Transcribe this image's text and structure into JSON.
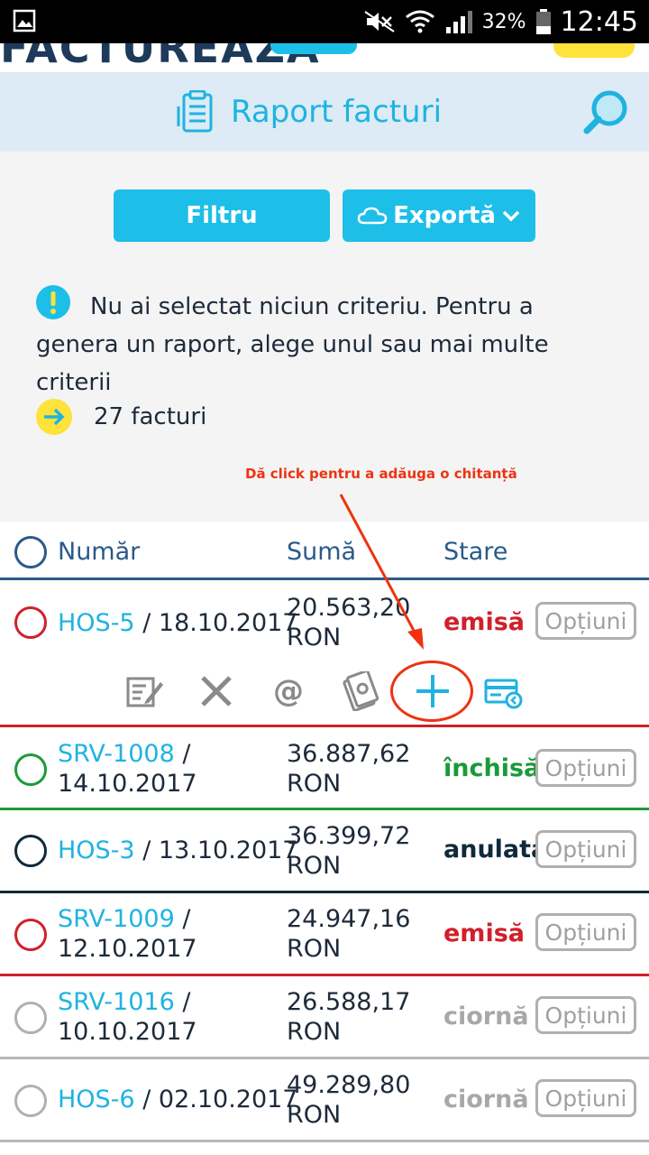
{
  "status_bar": {
    "battery_pct": "32%",
    "time": "12:45"
  },
  "app": {
    "logo_fragment": "FACTUREAZA"
  },
  "header": {
    "title": "Raport facturi"
  },
  "filters": {
    "filter_label": "Filtru",
    "export_label": "Exportă"
  },
  "notice": {
    "text": "Nu ai selectat niciun criteriu. Pentru a genera un raport, alege unul sau mai multe criterii",
    "count": "27 facturi"
  },
  "hint": "Dă click pentru a adăuga o chitanță",
  "table": {
    "headers": {
      "number": "Număr",
      "sum": "Sumă",
      "status": "Stare"
    },
    "options_label": "Opțiuni",
    "rows": [
      {
        "code": "HOS-5",
        "date": "/ 18.10.2017",
        "amount": "20.563,20",
        "currency": "RON",
        "status": "emisă",
        "status_color": "#d0202a"
      },
      {
        "code": "SRV-1008",
        "date": "/ 14.10.2017",
        "amount": "36.887,62",
        "currency": "RON",
        "status": "închisă",
        "status_color": "#1a9a3a"
      },
      {
        "code": "HOS-3",
        "date": "/ 13.10.2017",
        "amount": "36.399,72",
        "currency": "RON",
        "status": "anulată",
        "status_color": "#0f2a3a"
      },
      {
        "code": "SRV-1009",
        "date": "/ 12.10.2017",
        "amount": "24.947,16",
        "currency": "RON",
        "status": "emisă",
        "status_color": "#d0202a"
      },
      {
        "code": "SRV-1016",
        "date": "/ 10.10.2017",
        "amount": "26.588,17",
        "currency": "RON",
        "status": "ciornă",
        "status_color": "#a8a8a8"
      },
      {
        "code": "HOS-6",
        "date": "/ 02.10.2017",
        "amount": "49.289,80",
        "currency": "RON",
        "status": "ciornă",
        "status_color": "#a8a8a8"
      }
    ]
  },
  "row_actions": [
    "edit-icon",
    "cancel-icon",
    "email-icon",
    "payment-icon",
    "add-receipt-icon",
    "card-icon"
  ]
}
